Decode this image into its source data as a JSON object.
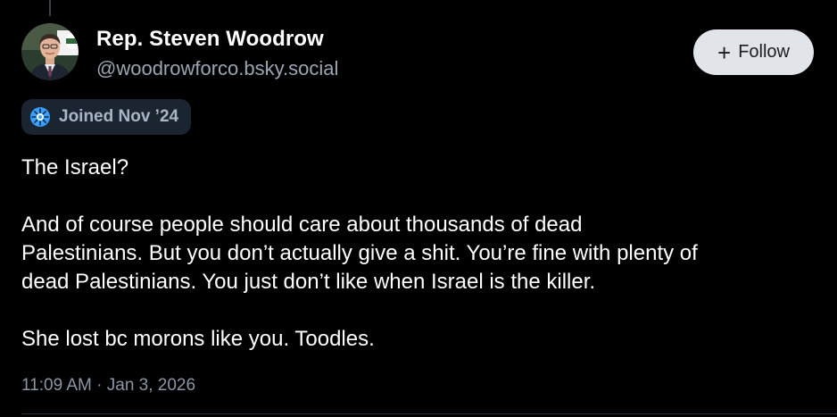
{
  "post": {
    "author": {
      "display_name": "Rep. Steven Woodrow",
      "handle": "@woodrowforco.bsky.social",
      "avatar_icon": "portrait-avatar"
    },
    "follow_button": {
      "icon": "plus-icon",
      "icon_glyph": "+",
      "label": "Follow"
    },
    "joined_badge": {
      "icon": "new-account-badge-icon",
      "label": "Joined Nov ’24"
    },
    "text_lines": [
      "The Israel?",
      "",
      "And of course people should care about thousands of dead",
      "Palestinians. But you don’t actually give a shit. You’re fine with plenty of",
      "dead Palestinians. You just don’t like when Israel is the killer.",
      "",
      "She lost bc morons like you. Toodles."
    ],
    "timestamp": "11:09 AM · Jan 3, 2026"
  },
  "colors": {
    "background": "#000000",
    "name_text": "#ffffff",
    "handle_text": "#9aa6b3",
    "follow_button_bg": "#e1e5ea",
    "badge_bg": "#1b2431",
    "badge_text": "#a8b6c6",
    "timestamp_text": "#8b97a5"
  }
}
